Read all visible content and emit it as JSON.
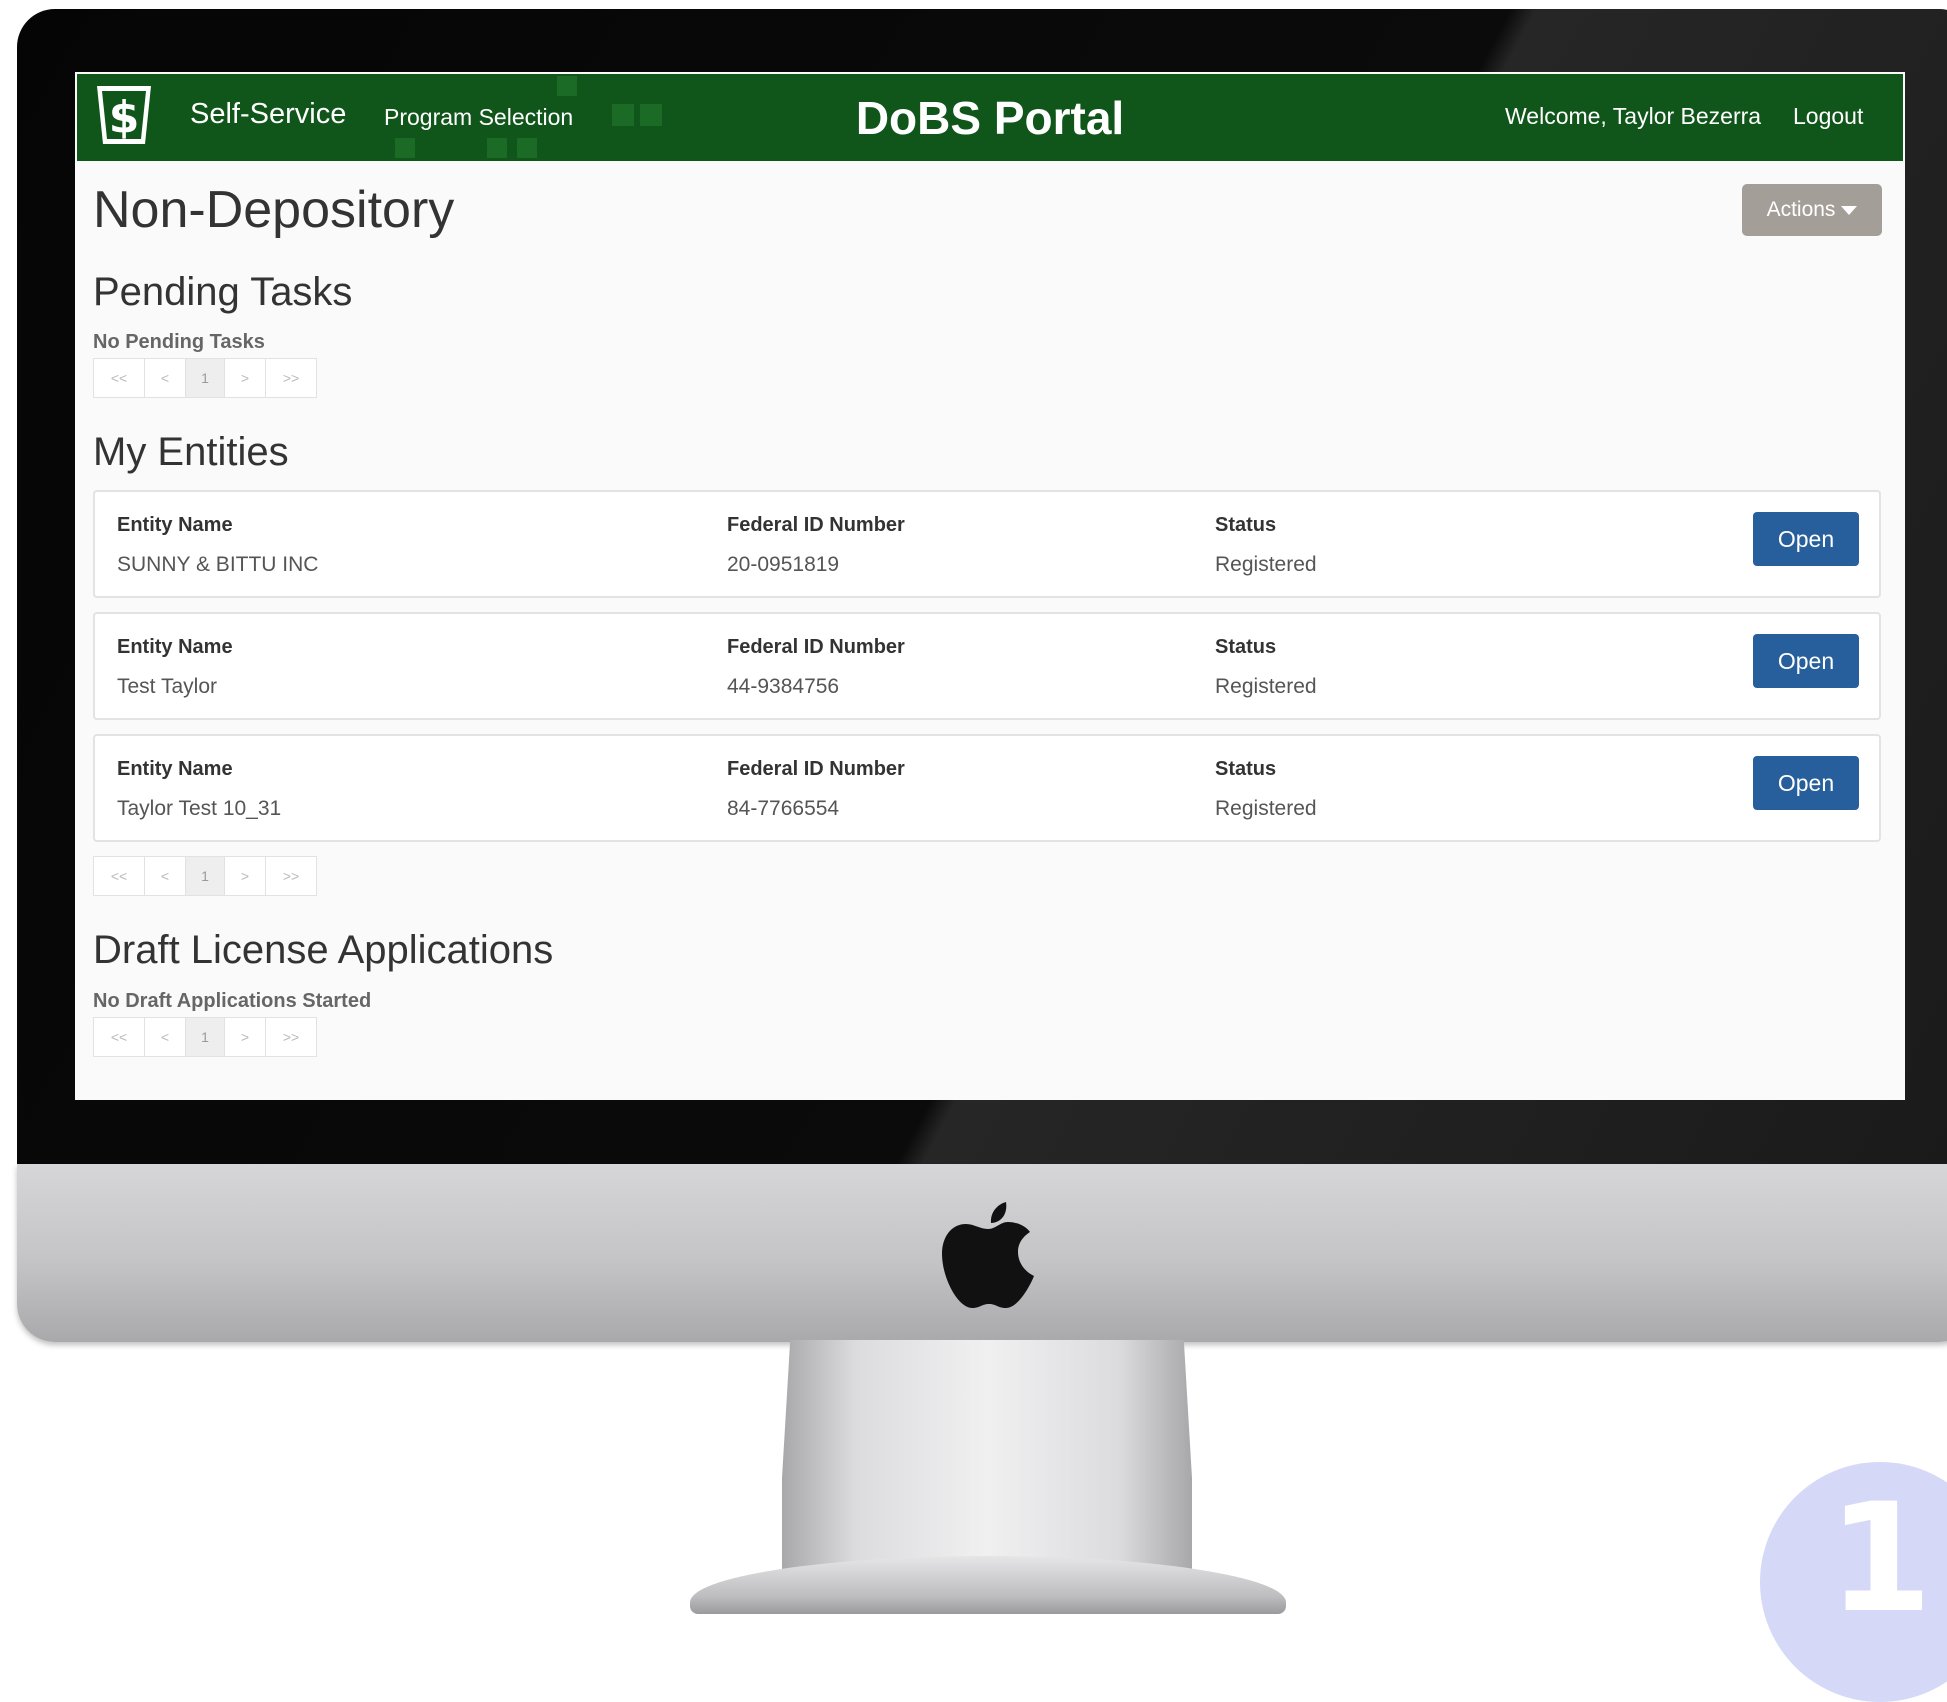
{
  "navbar": {
    "brand_icon": "keystone-dollar-icon",
    "self_service": "Self-Service",
    "program_selection": "Program Selection",
    "portal_title": "DoBS Portal",
    "welcome": "Welcome, Taylor Bezerra",
    "logout": "Logout",
    "background_color": "#10561a"
  },
  "page": {
    "title": "Non-Depository",
    "actions_label": "Actions"
  },
  "pending_tasks": {
    "heading": "Pending Tasks",
    "empty_message": "No Pending Tasks"
  },
  "my_entities": {
    "heading": "My Entities",
    "columns": {
      "name": "Entity Name",
      "federal_id": "Federal ID Number",
      "status": "Status"
    },
    "open_label": "Open",
    "rows": [
      {
        "name": "SUNNY & BITTU INC",
        "federal_id": "20-0951819",
        "status": "Registered"
      },
      {
        "name": "Test Taylor",
        "federal_id": "44-9384756",
        "status": "Registered"
      },
      {
        "name": "Taylor Test 10_31",
        "federal_id": "84-7766554",
        "status": "Registered"
      }
    ]
  },
  "draft_applications": {
    "heading": "Draft License Applications",
    "empty_message": "No Draft Applications Started"
  },
  "pagination": {
    "first": "<<",
    "prev": "<",
    "page": "1",
    "next": ">",
    "last": ">>"
  },
  "colors": {
    "open_button": "#265f9b",
    "actions_button": "#a39e97",
    "badge": "#d5d9f7"
  },
  "badge": {
    "number": "1"
  }
}
